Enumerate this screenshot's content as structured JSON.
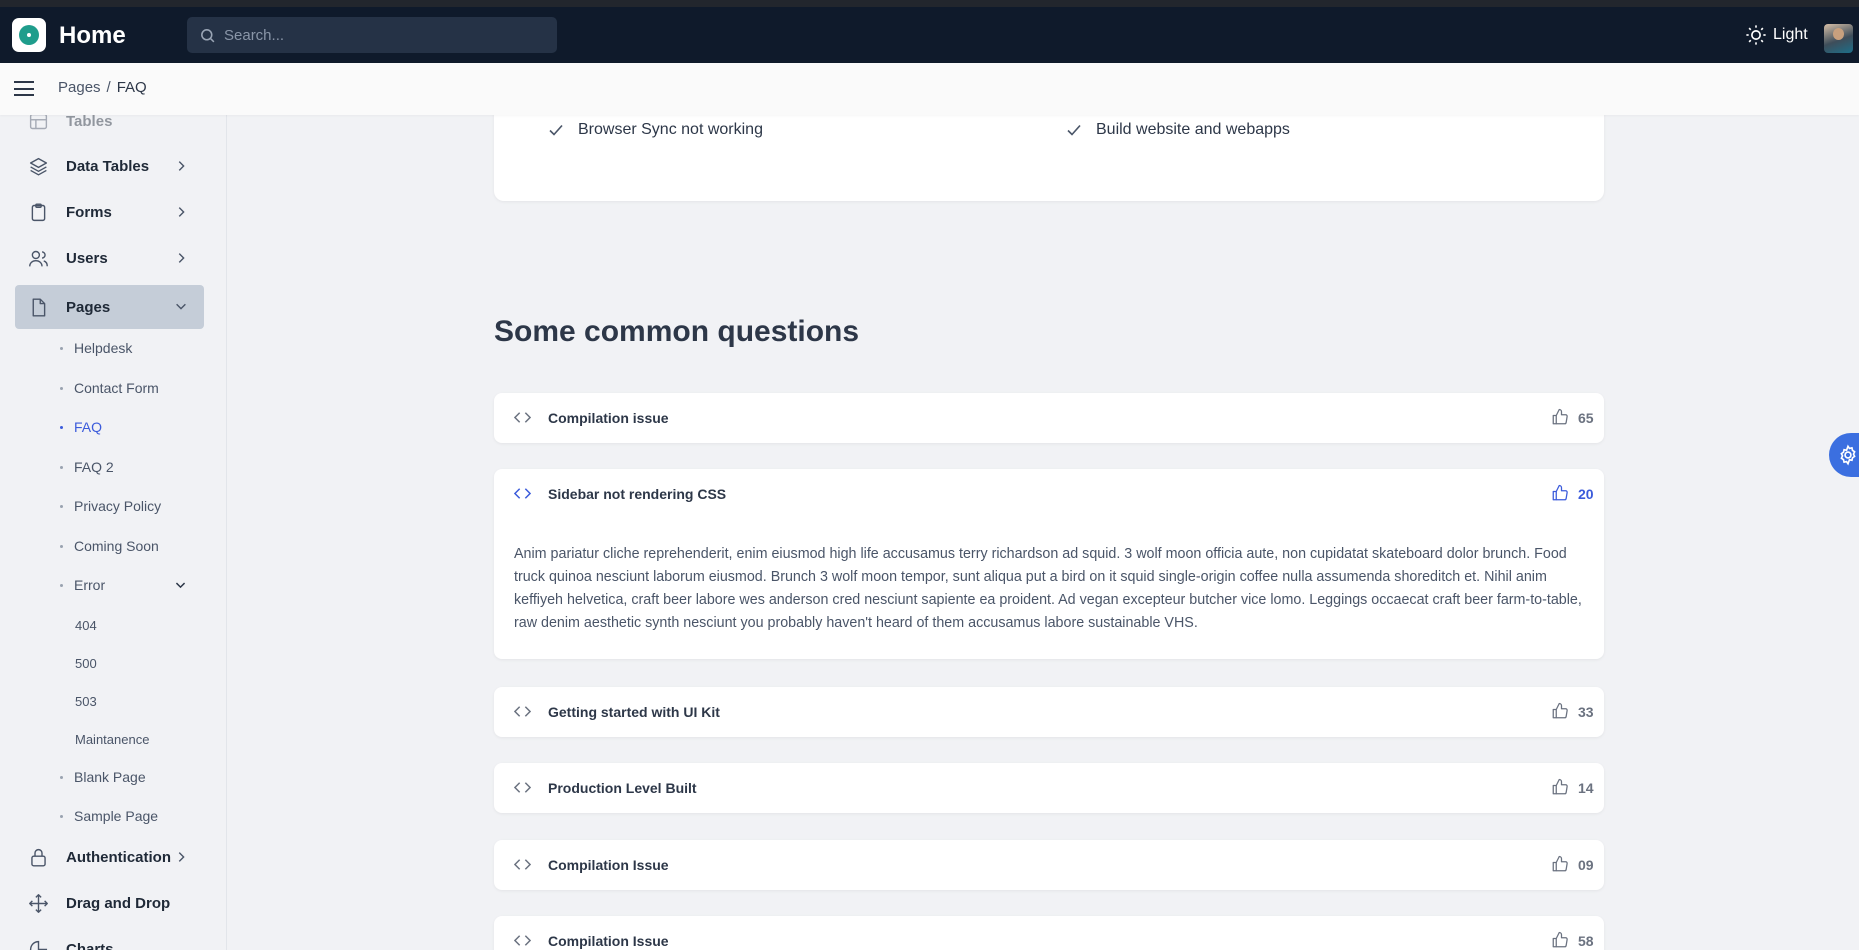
{
  "header": {
    "title": "Home",
    "search_placeholder": "Search...",
    "theme_label": "Light"
  },
  "breadcrumb": {
    "parent": "Pages",
    "separator": "/",
    "current": "FAQ"
  },
  "sidebar": {
    "faded_item": "Tables",
    "items": [
      {
        "label": "Data Tables",
        "icon": "layers-icon"
      },
      {
        "label": "Forms",
        "icon": "clipboard-icon"
      },
      {
        "label": "Users",
        "icon": "users-icon"
      },
      {
        "label": "Pages",
        "icon": "file-icon",
        "active": true
      },
      {
        "label": "Authentication",
        "icon": "lock-icon"
      },
      {
        "label": "Drag and Drop",
        "icon": "move-icon"
      },
      {
        "label": "Charts",
        "icon": "chart-icon"
      }
    ],
    "pages_sub": [
      {
        "label": "Helpdesk"
      },
      {
        "label": "Contact Form"
      },
      {
        "label": "FAQ",
        "active": true
      },
      {
        "label": "FAQ 2"
      },
      {
        "label": "Privacy Policy"
      },
      {
        "label": "Coming Soon"
      },
      {
        "label": "Error"
      }
    ],
    "error_sub": [
      "404",
      "500",
      "503",
      "Maintanence"
    ],
    "pages_sub_after": [
      "Blank Page",
      "Sample Page"
    ]
  },
  "top_card": {
    "left_item": "Browser Sync not working",
    "right_item": "Build website and webapps"
  },
  "faq": {
    "section_title": "Some common questions",
    "items": [
      {
        "question": "Compilation issue",
        "count": "65"
      },
      {
        "question": "Sidebar not rendering CSS",
        "count": "20",
        "open": true,
        "answer": "Anim pariatur cliche reprehenderit, enim eiusmod high life accusamus terry richardson ad squid. 3 wolf moon officia aute, non cupidatat skateboard dolor brunch. Food truck quinoa nesciunt laborum eiusmod. Brunch 3 wolf moon tempor, sunt aliqua put a bird on it squid single-origin coffee nulla assumenda shoreditch et. Nihil anim keffiyeh helvetica, craft beer labore wes anderson cred nesciunt sapiente ea proident. Ad vegan excepteur butcher vice lomo. Leggings occaecat craft beer farm-to-table, raw denim aesthetic synth nesciunt you probably haven't heard of them accusamus labore sustainable VHS."
      },
      {
        "question": "Getting started with UI Kit",
        "count": "33"
      },
      {
        "question": "Production Level Built",
        "count": "14"
      },
      {
        "question": "Compilation Issue",
        "count": "09"
      },
      {
        "question": "Compilation Issue",
        "count": "58"
      }
    ]
  },
  "colors": {
    "topbar": "#0f1a2b",
    "accent": "#3b5bdb",
    "sidebar_active": "#c5cdd8"
  }
}
